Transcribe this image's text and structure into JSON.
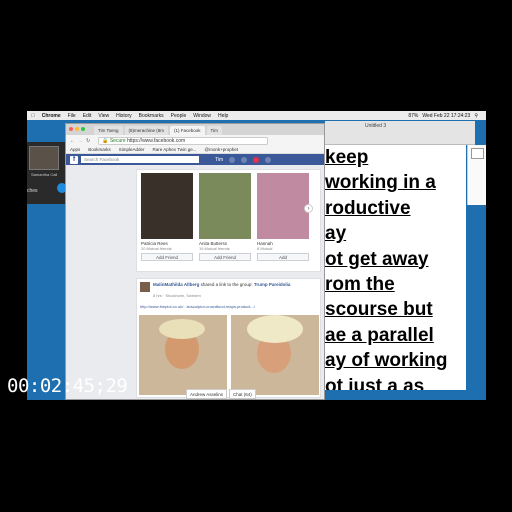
{
  "menubar": {
    "app": "Chrome",
    "items": [
      "File",
      "Edit",
      "View",
      "History",
      "Bookmarks",
      "People",
      "Window",
      "Help"
    ],
    "clock": "Wed Feb 22  17:24:23",
    "battery": "87%"
  },
  "call": {
    "caller": "Samantha Call",
    "shares": "ches"
  },
  "browser": {
    "tabs": [
      "Tim Tseng",
      "(8)merachine (8m",
      "(1) Facebook",
      "Tim"
    ],
    "active_tab": 2,
    "url_secure": "Secure",
    "url": "https://www.facebook.com",
    "bookmarks": [
      "Apps",
      "Bookmarks",
      "SimpleAdder",
      "Rare Aphex Twin ge...",
      "@monk+prophet"
    ]
  },
  "facebook": {
    "search_placeholder": "Search Facebook",
    "user": "Tim",
    "friends": [
      {
        "name": "Patricia Rees",
        "mutual": "20 Mutual friends",
        "button": "Add Friend",
        "color": "#3a302a"
      },
      {
        "name": "Anita Butterss",
        "mutual": "19 Mutual friends",
        "button": "Add Friend",
        "color": "#7a8a5a"
      },
      {
        "name": "Hannah",
        "mutual": "8 Mutual",
        "button": "Add",
        "color": "#c08aa0"
      }
    ],
    "post": {
      "author": "MalinMathilda Allberg",
      "action": "shared a link to the group:",
      "group": "Trump Pareidolia",
      "meta": "8 hrs · Stockholm, Sweden",
      "link": "http://www.theplot.co.uk/...ts/sculptor-crowdfund-maps-product.../"
    },
    "chats": [
      "Andrew Asselins",
      "Chat (64)"
    ]
  },
  "document": {
    "title": "Untitled 3",
    "lines": [
      "keep",
      "working in a",
      "roductive",
      "ay",
      "ot get away",
      "rom the",
      "scourse but",
      "ae a parallel",
      "ay of working",
      "ot just a as"
    ]
  },
  "video": {
    "timecode": "00:02:45;29"
  }
}
